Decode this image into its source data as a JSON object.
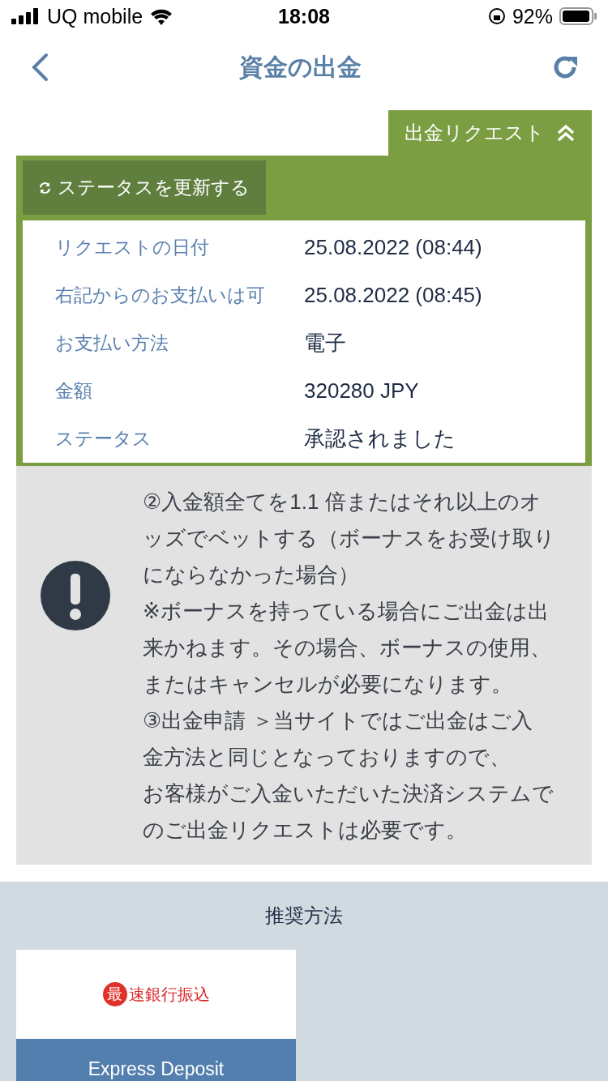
{
  "status_bar": {
    "carrier": "UQ mobile",
    "time": "18:08",
    "battery": "92%"
  },
  "header": {
    "title": "資金の出金"
  },
  "request_tab": {
    "label": "出金リクエスト",
    "expanded": true
  },
  "refresh_button": {
    "label": "ステータスを更新する"
  },
  "details": [
    {
      "label": "リクエストの日付",
      "value": "25.08.2022 (08:44)"
    },
    {
      "label": "右記からのお支払いは可",
      "value": "25.08.2022 (08:45)"
    },
    {
      "label": "お支払い方法",
      "value": "電子"
    },
    {
      "label": "金額",
      "value": "320280 JPY"
    },
    {
      "label": "ステータス",
      "value": "承認されました"
    }
  ],
  "notice": {
    "lines": [
      "②入金額全てを1.1 倍またはそれ以上のオ",
      "ッズでベットする（ボーナスをお受け取り",
      "にならなかった場合）",
      "※ボーナスを持っている場合にご出金は出",
      "来かねます。その場合、ボーナスの使用、",
      "またはキャンセルが必要になります。",
      "③出金申請 ＞当サイトではご出金はご入",
      "金方法と同じとなっておりますので、",
      "お客様がご入金いただいた決済システムで",
      "のご出金リクエストは必要です。"
    ]
  },
  "recommended": {
    "title": "推奨方法",
    "methods": [
      {
        "logo_text": "速銀行振込",
        "logo_badge": "最",
        "name": "Express Deposit"
      }
    ]
  }
}
